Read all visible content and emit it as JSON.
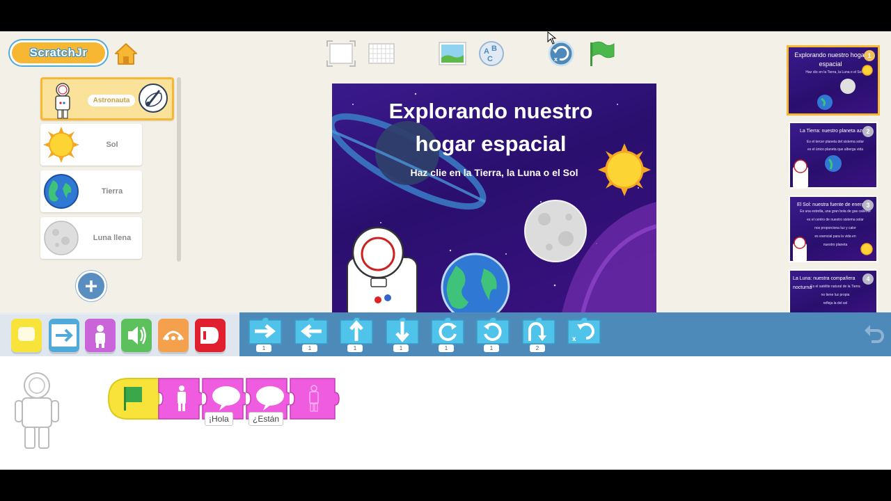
{
  "app": {
    "logo_text": "ScratchJr",
    "colors": {
      "accent": "#f8b733",
      "blocks_bar": "#4d89b9",
      "motion": "#4fa9d9",
      "looks": "#c965d8",
      "script_looks": "#ef5ce0",
      "trigger": "#f7e339"
    }
  },
  "toolbar": {
    "icons": [
      "home-icon",
      "fullscreen-icon",
      "grid-icon",
      "background-icon",
      "text-icon",
      "reset-icon",
      "green-flag-icon"
    ]
  },
  "sprites": [
    {
      "label": "Astronauta",
      "selected": true,
      "icon": "astronaut-icon"
    },
    {
      "label": "Sol",
      "icon": "sun-icon"
    },
    {
      "label": "Tierra",
      "icon": "earth-icon"
    },
    {
      "label": "Luna llena",
      "icon": "moon-icon"
    }
  ],
  "stage": {
    "title_line1": "Explorando nuestro",
    "title_line2": "hogar espacial",
    "subtitle": "Haz clie en la Tierra, la Luna o el Sol"
  },
  "pages": [
    {
      "number": "1",
      "title": "Explorando nuestro hogar espacial",
      "lines": [
        "Haz clic en la Tierra, la Luna o el Sol"
      ],
      "current": true
    },
    {
      "number": "2",
      "title": "La Tierra: nuestro planeta azul",
      "lines": [
        "Es el tercer planeta del sistema solar",
        "es el único planeta que alberga vida"
      ]
    },
    {
      "number": "3",
      "title": "El Sol: nuestra fuente de energía",
      "lines": [
        "Es una estrella, una gran bola de gas caliente",
        "es el centro de nuestro sistema solar",
        "nos proporciona luz y calor",
        "es esencial para la vida en",
        "nuestro planeta"
      ]
    },
    {
      "number": "4",
      "title": "La Luna: nuestra compañera nocturna",
      "lines": [
        "Es el satélite natural de la Tierra",
        "no tiene luz propia",
        "refleja la del sol"
      ]
    }
  ],
  "categories": [
    {
      "name": "triggering",
      "color": "#f7e339"
    },
    {
      "name": "motion",
      "color": "#4fa9d9"
    },
    {
      "name": "looks",
      "color": "#c965d8"
    },
    {
      "name": "sound",
      "color": "#5cc05c"
    },
    {
      "name": "control",
      "color": "#f5a04c"
    },
    {
      "name": "end",
      "color": "#e0202e"
    }
  ],
  "motion_blocks": [
    {
      "name": "move-right",
      "value": "1"
    },
    {
      "name": "move-left",
      "value": "1"
    },
    {
      "name": "move-up",
      "value": "1"
    },
    {
      "name": "move-down",
      "value": "1"
    },
    {
      "name": "turn-right",
      "value": "1"
    },
    {
      "name": "turn-left",
      "value": "1"
    },
    {
      "name": "hop",
      "value": "2"
    },
    {
      "name": "go-home",
      "value": ""
    }
  ],
  "script": {
    "say1": "¡Hola",
    "say2": "¿Están"
  }
}
